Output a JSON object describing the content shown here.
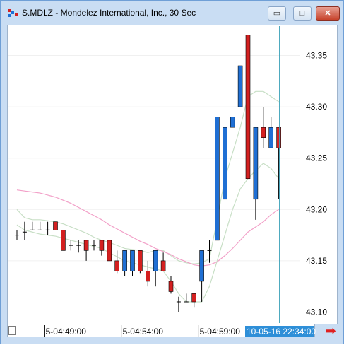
{
  "window": {
    "title": "S.MDLZ - Mondelez International, Inc., 30 Sec",
    "minimize_glyph": "▭",
    "maximize_glyph": "□",
    "close_glyph": "✕",
    "icons": [
      "app-chart-icon",
      "minimize-icon",
      "maximize-icon",
      "close-icon",
      "scroll-right-arrow-icon"
    ]
  },
  "colors": {
    "up_bar": "#1f6fd4",
    "down_bar": "#d42020",
    "neutral_bar": "#000000",
    "moving_average": "#f2a0c8",
    "band": "#c8dfc6",
    "cursor_line": "#3aa0b8",
    "cursor_label_bg": "#2e8fd8"
  },
  "chart_data": {
    "type": "candlestick",
    "title": "S.MDLZ - Mondelez International, Inc., 30 Sec",
    "ylim": [
      43.085,
      43.385
    ],
    "y_ticks": [
      43.1,
      43.15,
      43.2,
      43.25,
      43.3,
      43.35
    ],
    "y_tick_labels": [
      "43.10",
      "43.15",
      "43.20",
      "43.25",
      "43.30",
      "43.35"
    ],
    "x_tick_labels": [
      "5-04:49:00",
      "5-04:54:00",
      "5-04:59:00"
    ],
    "x_tick_bar_index": [
      4,
      14,
      24
    ],
    "cursor_label": "10-05-16 22:34:00",
    "grid": true,
    "bars": [
      {
        "o": 43.175,
        "h": 43.18,
        "l": 43.17,
        "c": 43.175
      },
      {
        "o": 43.178,
        "h": 43.188,
        "l": 43.17,
        "c": 43.178
      },
      {
        "o": 43.18,
        "h": 43.188,
        "l": 43.18,
        "c": 43.18
      },
      {
        "o": 43.18,
        "h": 43.188,
        "l": 43.18,
        "c": 43.18
      },
      {
        "o": 43.18,
        "h": 43.188,
        "l": 43.175,
        "c": 43.18
      },
      {
        "o": 43.188,
        "h": 43.188,
        "l": 43.18,
        "c": 43.18
      },
      {
        "o": 43.18,
        "h": 43.18,
        "l": 43.16,
        "c": 43.16
      },
      {
        "o": 43.165,
        "h": 43.17,
        "l": 43.16,
        "c": 43.165
      },
      {
        "o": 43.165,
        "h": 43.17,
        "l": 43.158,
        "c": 43.165
      },
      {
        "o": 43.17,
        "h": 43.17,
        "l": 43.15,
        "c": 43.16
      },
      {
        "o": 43.165,
        "h": 43.17,
        "l": 43.16,
        "c": 43.165
      },
      {
        "o": 43.17,
        "h": 43.17,
        "l": 43.155,
        "c": 43.16
      },
      {
        "o": 43.17,
        "h": 43.17,
        "l": 43.15,
        "c": 43.15
      },
      {
        "o": 43.15,
        "h": 43.16,
        "l": 43.138,
        "c": 43.14
      },
      {
        "o": 43.14,
        "h": 43.16,
        "l": 43.135,
        "c": 43.16
      },
      {
        "o": 43.14,
        "h": 43.16,
        "l": 43.135,
        "c": 43.16
      },
      {
        "o": 43.16,
        "h": 43.16,
        "l": 43.138,
        "c": 43.14
      },
      {
        "o": 43.14,
        "h": 43.15,
        "l": 43.125,
        "c": 43.13
      },
      {
        "o": 43.14,
        "h": 43.16,
        "l": 43.125,
        "c": 43.16
      },
      {
        "o": 43.15,
        "h": 43.158,
        "l": 43.14,
        "c": 43.14
      },
      {
        "o": 43.13,
        "h": 43.135,
        "l": 43.118,
        "c": 43.12
      },
      {
        "o": 43.11,
        "h": 43.115,
        "l": 43.1,
        "c": 43.11
      },
      {
        "o": 43.11,
        "h": 43.118,
        "l": 43.11,
        "c": 43.11
      },
      {
        "o": 43.118,
        "h": 43.118,
        "l": 43.105,
        "c": 43.11
      },
      {
        "o": 43.13,
        "h": 43.16,
        "l": 43.11,
        "c": 43.16
      },
      {
        "o": 43.16,
        "h": 43.17,
        "l": 43.148,
        "c": 43.16
      },
      {
        "o": 43.17,
        "h": 43.29,
        "l": 43.17,
        "c": 43.29
      },
      {
        "o": 43.21,
        "h": 43.28,
        "l": 43.21,
        "c": 43.28
      },
      {
        "o": 43.28,
        "h": 43.29,
        "l": 43.28,
        "c": 43.29
      },
      {
        "o": 43.3,
        "h": 43.34,
        "l": 43.3,
        "c": 43.34
      },
      {
        "o": 43.37,
        "h": 43.37,
        "l": 43.23,
        "c": 43.23
      },
      {
        "o": 43.21,
        "h": 43.28,
        "l": 43.19,
        "c": 43.28
      },
      {
        "o": 43.28,
        "h": 43.3,
        "l": 43.26,
        "c": 43.27
      },
      {
        "o": 43.26,
        "h": 43.29,
        "l": 43.26,
        "c": 43.28
      },
      {
        "o": 43.28,
        "h": 43.28,
        "l": 43.21,
        "c": 43.26
      }
    ],
    "moving_average": [
      43.219,
      43.218,
      43.217,
      43.216,
      43.214,
      43.212,
      43.209,
      43.206,
      43.202,
      43.198,
      43.194,
      43.19,
      43.185,
      43.181,
      43.177,
      43.173,
      43.169,
      43.166,
      43.162,
      43.159,
      43.156,
      43.152,
      43.149,
      43.146,
      43.145,
      43.146,
      43.149,
      43.155,
      43.162,
      43.17,
      43.178,
      43.183,
      43.188,
      43.195,
      43.2
    ],
    "upper_band": [
      43.2,
      43.192,
      43.19,
      43.19,
      43.189,
      43.188,
      43.186,
      43.183,
      43.18,
      43.177,
      43.173,
      43.17,
      43.168,
      43.165,
      43.162,
      43.161,
      43.16,
      43.158,
      43.16,
      43.16,
      43.155,
      43.15,
      43.148,
      43.147,
      43.148,
      43.152,
      43.19,
      43.23,
      43.255,
      43.28,
      43.31,
      43.315,
      43.315,
      43.31,
      43.305
    ],
    "lower_band": [
      43.185,
      43.18,
      43.178,
      43.176,
      43.175,
      43.174,
      43.172,
      43.17,
      43.168,
      43.166,
      43.164,
      43.162,
      43.158,
      43.154,
      43.15,
      43.148,
      43.146,
      43.144,
      43.142,
      43.14,
      43.13,
      43.118,
      43.11,
      43.11,
      43.11,
      43.125,
      43.15,
      43.175,
      43.2,
      43.22,
      43.23,
      43.238,
      43.245,
      43.24,
      43.23
    ]
  },
  "time_axis": {
    "labels": [
      "5-04:49:00",
      "5-04:54:00",
      "5-04:59:00"
    ],
    "cursor_label": "10-05-16 22:34:00"
  }
}
